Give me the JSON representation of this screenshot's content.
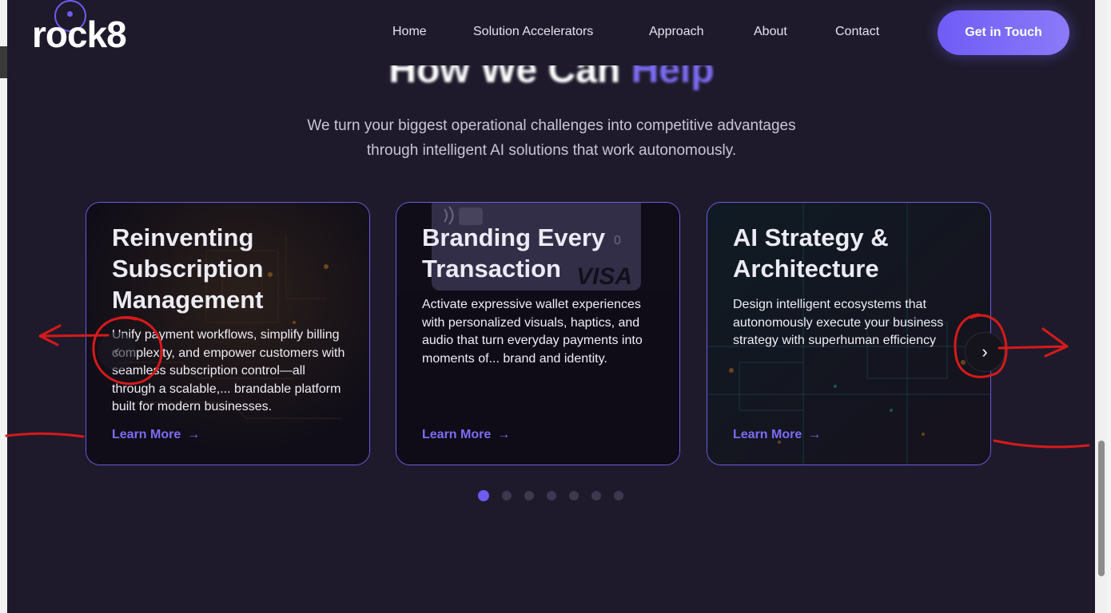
{
  "brand": {
    "logo_text": "rock8"
  },
  "nav": {
    "items": [
      {
        "label": "Home"
      },
      {
        "label": "Solution Accelerators"
      },
      {
        "label": "Approach"
      },
      {
        "label": "About"
      },
      {
        "label": "Contact"
      }
    ],
    "cta_label": "Get in Touch"
  },
  "hero": {
    "heading_main": "How We Can ",
    "heading_accent": "Help",
    "subtitle_line1": "We turn your biggest operational challenges into competitive advantages",
    "subtitle_line2": "through intelligent AI solutions that work autonomously."
  },
  "cards": [
    {
      "title": "Reinventing Subscription Management",
      "description": "Unify payment workflows, simplify billing complexity, and empower customers with seamless subscription control—all through a scalable,... brandable platform built for modern businesses.",
      "link": "Learn More"
    },
    {
      "title": "Branding Every Transaction",
      "description": "Activate expressive wallet experiences with personalized visuals, haptics, and audio that turn everyday payments into moments of... brand and identity.",
      "link": "Learn More",
      "card_image_text": "VISA"
    },
    {
      "title": "AI Strategy & Architecture",
      "description": "Design intelligent ecosystems that autonomously execute your business strategy with superhuman efficiency",
      "link": "Learn More"
    }
  ],
  "carousel": {
    "total_slides": 7,
    "active_index": 0
  },
  "icons": {
    "next": "chevron-right-icon",
    "prev": "chevron-left-icon",
    "link_arrow": "arrow-right-icon"
  },
  "colors": {
    "accent": "#6e5cf0",
    "background": "#1e1a2b",
    "annotation": "#d61a1a"
  }
}
